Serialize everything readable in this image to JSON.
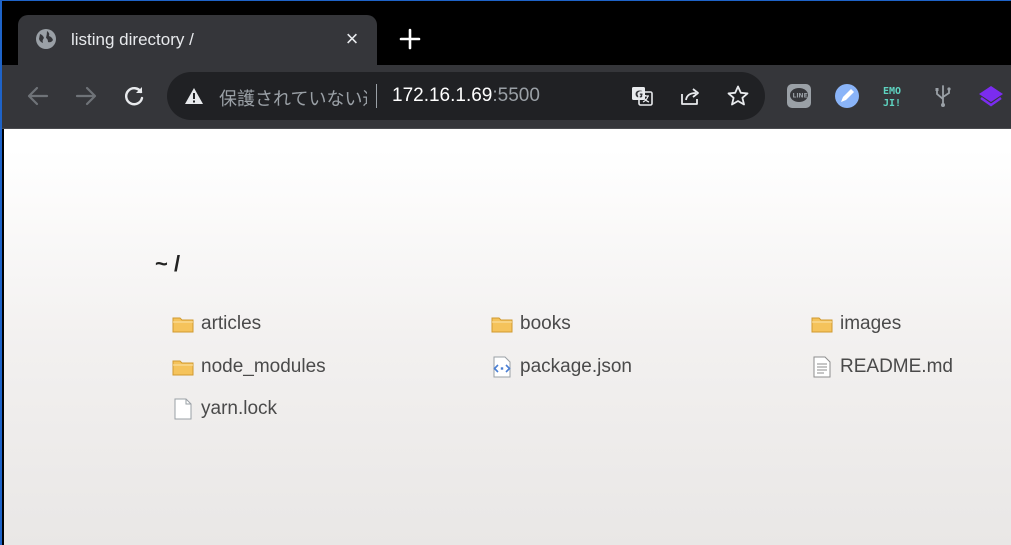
{
  "tab": {
    "title": "listing directory /",
    "favicon": "globe-icon",
    "close": "×"
  },
  "toolbar": {
    "back": "arrow-left-icon",
    "forward": "arrow-right-icon",
    "reload": "reload-icon",
    "omnibox": {
      "security_text": "保護されていない通信",
      "url_host": "172.16.1.69",
      "url_port": ":5500",
      "icons": [
        "translate-icon",
        "share-icon",
        "star-icon"
      ]
    },
    "extensions": [
      "line-extension-icon",
      "pencil-extension-icon",
      "emoji-extension-icon",
      "usb-extension-icon",
      "layers-extension-icon"
    ]
  },
  "page": {
    "breadcrumb": "~ /",
    "files": [
      {
        "name": "articles",
        "type": "folder"
      },
      {
        "name": "books",
        "type": "folder"
      },
      {
        "name": "images",
        "type": "folder"
      },
      {
        "name": "node_modules",
        "type": "folder"
      },
      {
        "name": "package.json",
        "type": "json"
      },
      {
        "name": "README.md",
        "type": "text"
      },
      {
        "name": "yarn.lock",
        "type": "file"
      }
    ]
  },
  "colors": {
    "tab_strip": "#000000",
    "toolbar": "#35363a",
    "omnibox": "#202124",
    "folder": "#f5c35b",
    "text": "#4a4a4a"
  }
}
